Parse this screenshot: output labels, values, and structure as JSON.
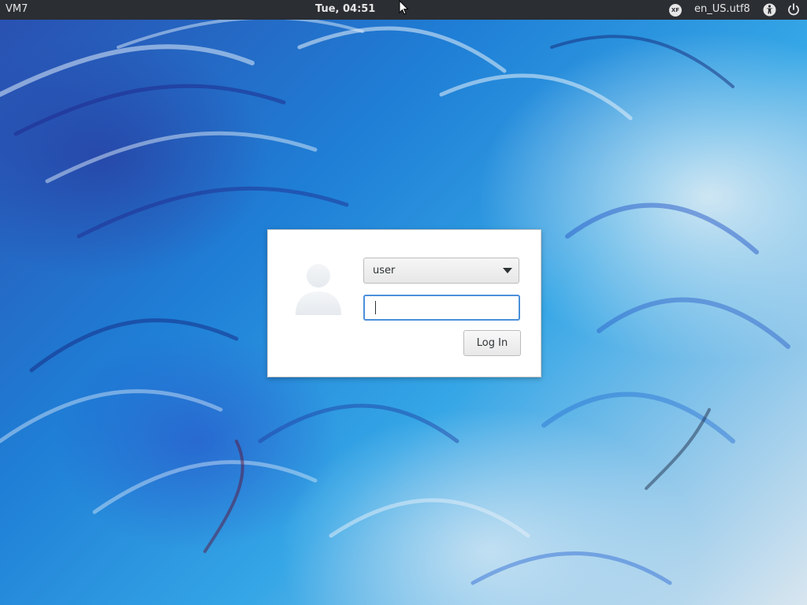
{
  "topbar": {
    "hostname": "VM7",
    "clock": "Tue, 04:51",
    "keyboard_layout_badge": "XF",
    "locale": "en_US.utf8",
    "accessibility_icon": "accessibility-icon",
    "power_icon": "power-icon",
    "background_color": "#2b2e33"
  },
  "login": {
    "avatar_icon": "user-avatar-icon",
    "selected_user": "user",
    "dropdown_icon": "chevron-down-icon",
    "password_value": "",
    "password_placeholder": "",
    "login_button_label": "Log In",
    "focus_color": "#4a90d9"
  },
  "wallpaper": {
    "description_colors": [
      "#2a4fb0",
      "#1f7fd6",
      "#35a6e6",
      "#d8e6ef"
    ]
  }
}
